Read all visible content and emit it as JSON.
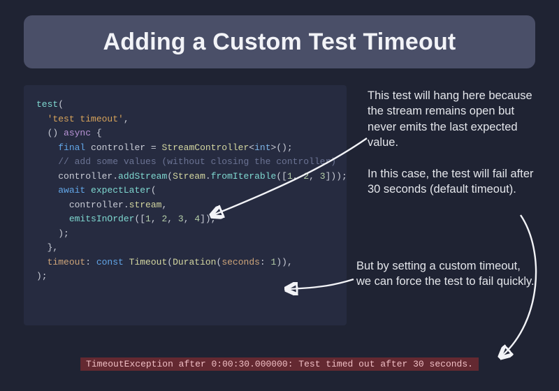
{
  "title": "Adding a Custom Test Timeout",
  "code": {
    "l1_test": "test",
    "l1_open": "(",
    "l2_str": "'test timeout'",
    "l2_comma": ",",
    "l3_open": "  () ",
    "l3_async": "async",
    "l3_brace": " {",
    "l4_final": "final",
    "l4_sp": " ",
    "l4_ctrl": "controller",
    "l4_eq": " = ",
    "l4_sc": "StreamController",
    "l4_lt": "<",
    "l4_int": "int",
    "l4_gt": ">",
    "l4_end": "();",
    "l5_cmt": "    // add some values (without closing the controller)",
    "l6_ctrl": "controller",
    "l6_dot": ".",
    "l6_add": "addStream",
    "l6_open": "(",
    "l6_stream": "Stream",
    "l6_dot2": ".",
    "l6_from": "fromIterable",
    "l6_open2": "([",
    "l6_n1": "1",
    "l6_c1": ", ",
    "l6_n2": "2",
    "l6_c2": ", ",
    "l6_n3": "3",
    "l6_end": "]));",
    "l7_await": "await",
    "l7_sp": " ",
    "l7_expect": "expectLater",
    "l7_open": "(",
    "l8_ctrl": "controller",
    "l8_dot": ".",
    "l8_stream": "stream",
    "l8_comma": ",",
    "l9_emits": "emitsInOrder",
    "l9_open": "([",
    "l9_n1": "1",
    "l9_c1": ", ",
    "l9_n2": "2",
    "l9_c2": ", ",
    "l9_n3": "3",
    "l9_c3": ", ",
    "l9_n4": "4",
    "l9_end": "]),",
    "l10": "    );",
    "l11": "  },",
    "l12_timeout": "timeout",
    "l12_colon": ": ",
    "l12_const": "const",
    "l12_sp": " ",
    "l12_to": "Timeout",
    "l12_open": "(",
    "l12_dur": "Duration",
    "l12_open2": "(",
    "l12_sec": "seconds",
    "l12_colon2": ": ",
    "l12_n": "1",
    "l12_end": ")),",
    "l13": ");"
  },
  "annotations": {
    "a1": "This test will hang here because the stream remains open but never emits the last expected value.",
    "a2": "In this case, the test will fail after 30 seconds (default timeout).",
    "a3": "But by setting a custom timeout, we can force the test to fail quickly."
  },
  "error": "TimeoutException after 0:00:30.000000: Test timed out after 30 seconds."
}
